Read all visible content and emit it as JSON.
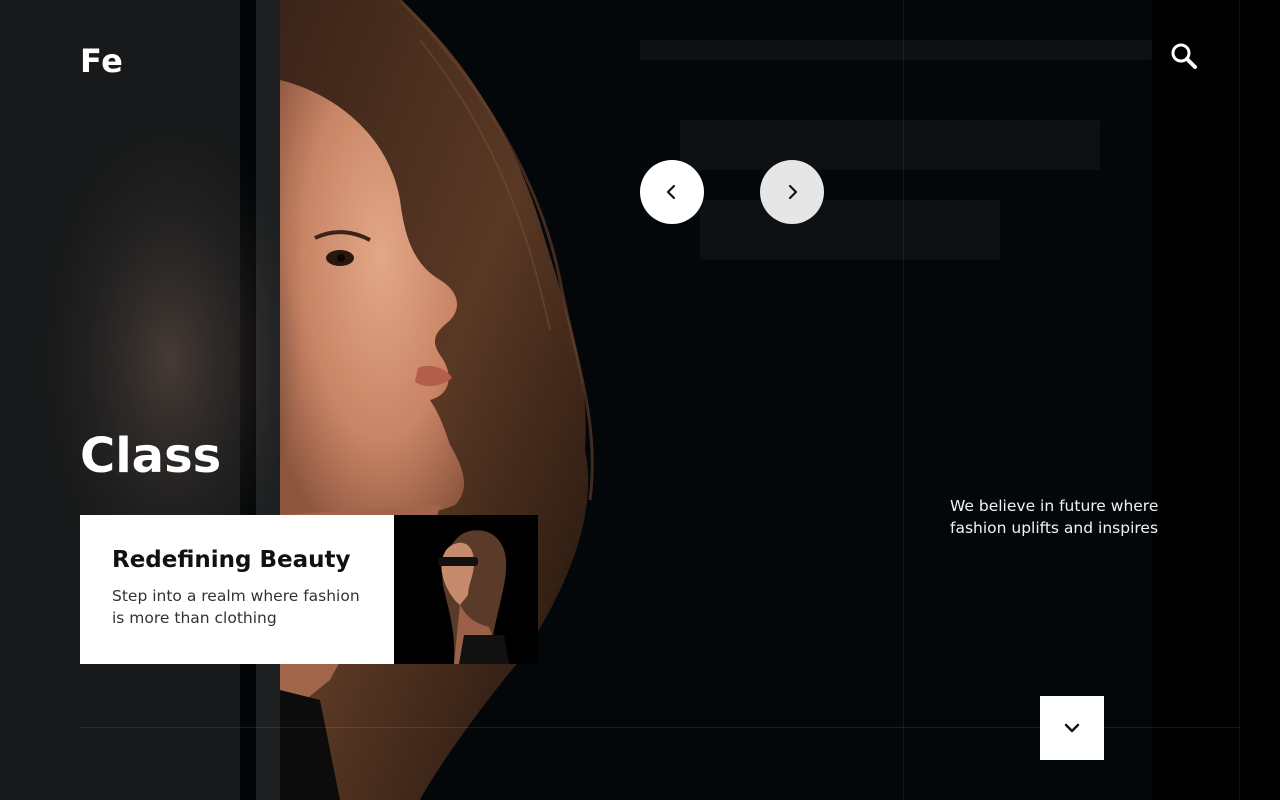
{
  "header": {
    "logo": "Fe",
    "search_icon": "search-icon"
  },
  "carousel": {
    "prev_icon": "chevron-left-icon",
    "next_icon": "chevron-right-icon"
  },
  "hero": {
    "headline": "Class",
    "card": {
      "title": "Redefining Beauty",
      "description": "Step into a realm where fashion is more than clothing"
    },
    "thumbnail": "blindfolded-woman-photo",
    "tagline": "We believe in future where fashion uplifts and inspires"
  },
  "footer": {
    "scroll_down_icon": "chevron-down-icon"
  },
  "colors": {
    "background": "#040709",
    "text": "#ffffff",
    "card_background": "#ffffff",
    "card_title": "#111111",
    "card_text": "#333333",
    "button_prev": "#ffffff",
    "button_next": "#e6e6e6"
  }
}
